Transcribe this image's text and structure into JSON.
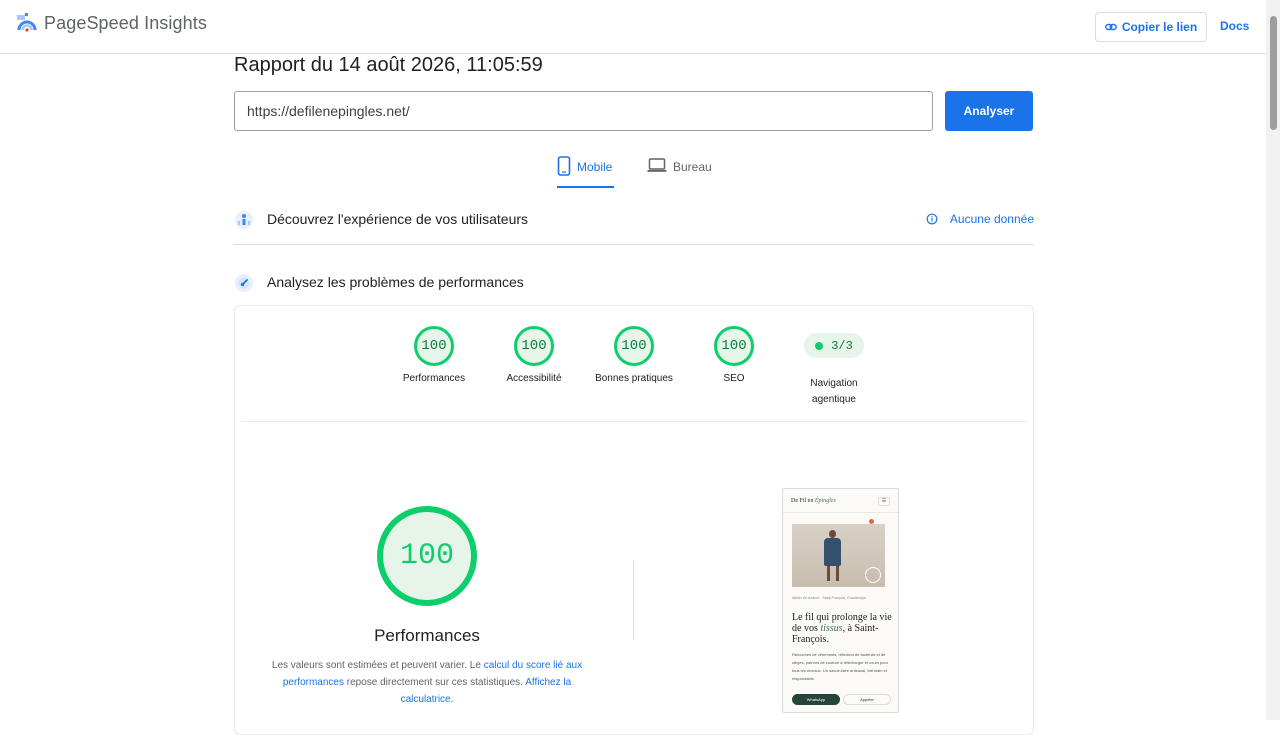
{
  "app": {
    "name": "PageSpeed Insights",
    "copy_link_label": "Copier le lien",
    "docs_label": "Docs"
  },
  "report": {
    "title": "Rapport du 14 août 2026, 11:05:59",
    "url_value": "https://defilenepingles.net/",
    "analyze_label": "Analyser"
  },
  "tabs": [
    {
      "label": "Mobile",
      "active": true,
      "icon": "smartphone-icon"
    },
    {
      "label": "Bureau",
      "active": false,
      "icon": "laptop-icon"
    }
  ],
  "sections": {
    "field_title": "Découvrez l'expérience de vos utilisateurs",
    "field_status": "Aucune donnée",
    "lab_title": "Analysez les problèmes de performances"
  },
  "scores": [
    {
      "label": "Performances",
      "value": "100"
    },
    {
      "label": "Accessibilité",
      "value": "100"
    },
    {
      "label": "Bonnes pratiques",
      "value": "100"
    },
    {
      "label": "SEO",
      "value": "100"
    }
  ],
  "agentic": {
    "value": "3/3",
    "label": "Navigation agentique"
  },
  "performance": {
    "score": "100",
    "title": "Performances",
    "note_prefix": "Les valeurs sont estimées et peuvent varier. Le ",
    "note_link1": "calcul du score lié aux performances",
    "note_middle": " repose directement sur ces statistiques. ",
    "note_link2": "Affichez la calculatrice",
    "note_suffix": "."
  },
  "preview": {
    "site_name_plain": "De Fil en ",
    "site_name_italic": "Épingles",
    "menu_glyph": "☰",
    "caption": "Atelier de couture · Saint-François, Guadeloupe",
    "headline_a": "Le fil qui prolonge la vie de vos ",
    "headline_italic": "tissus",
    "headline_b": ", à Saint-François.",
    "body": "Retouches de vêtements, réfection de fauteuils et de sièges, patrons de couture à télécharger et cours pour tous les niveaux. Un savoir-faire artisanal, fait main et responsable.",
    "button1": "WhatsApp",
    "button2": "Appeler"
  },
  "colors": {
    "accent": "#1a73e8",
    "pass": "#0cce6b",
    "pass_text": "#0c7d3d",
    "pass_bg": "#e6f4ea"
  }
}
